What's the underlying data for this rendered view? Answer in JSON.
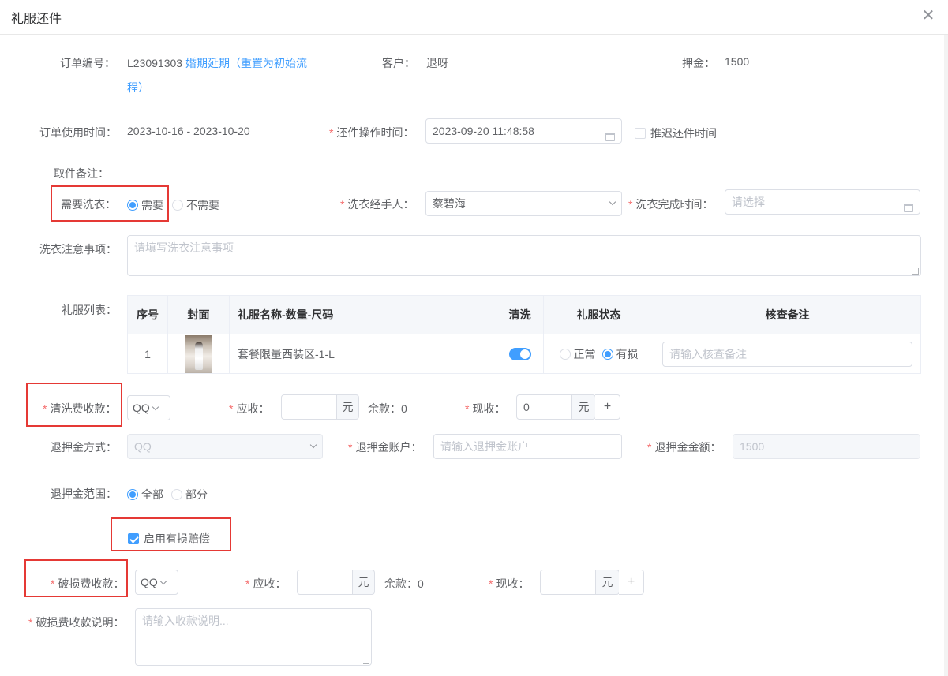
{
  "dialog": {
    "title": "礼服还件",
    "close_icon": "close-icon"
  },
  "order": {
    "no_label": "订单编号：",
    "no_value": "L23091303",
    "no_link_line1": "婚期延期（重置为初始流",
    "no_link_line2": "程）",
    "customer_label": "客户：",
    "customer_value": "退呀",
    "deposit_label": "押金：",
    "deposit_value": "1500",
    "use_time_label": "订单使用时间：",
    "use_time_value": "2023-10-16 - 2023-10-20",
    "return_time_label": "还件操作时间：",
    "return_time_value": "2023-09-20 11:48:58",
    "delay_label": "推迟还件时间",
    "pickup_note_label": "取件备注："
  },
  "wash": {
    "need_label": "需要洗衣：",
    "need_yes": "需要",
    "need_no": "不需要",
    "handler_label": "洗衣经手人：",
    "handler_value": "蔡碧海",
    "finish_label": "洗衣完成时间：",
    "finish_placeholder": "请选择",
    "notes_label": "洗衣注意事项：",
    "notes_placeholder": "请填写洗衣注意事项"
  },
  "dress_list": {
    "label": "礼服列表：",
    "headers": [
      "序号",
      "封面",
      "礼服名称-数量-尺码",
      "清洗",
      "礼服状态",
      "核查备注"
    ],
    "rows": [
      {
        "index": "1",
        "name": "套餐限量西装区-1-L",
        "status_normal": "正常",
        "status_damaged": "有损",
        "note_placeholder": "请输入核查备注"
      }
    ]
  },
  "cleaning_fee": {
    "label": "清洗费收款：",
    "method": "QQ",
    "receivable_label": "应收：",
    "unit": "元",
    "balance": "余款：0",
    "received_label": "现收：",
    "received_value": "0",
    "plus": "+"
  },
  "refund": {
    "method_label": "退押金方式：",
    "method_value": "QQ",
    "account_label": "退押金账户：",
    "account_placeholder": "请输入退押金账户",
    "amount_label": "退押金金额：",
    "amount_value": "1500",
    "scope_label": "退押金范围：",
    "scope_all": "全部",
    "scope_part": "部分"
  },
  "damage": {
    "enable_label": "启用有损赔偿",
    "fee_label": "破损费收款：",
    "method": "QQ",
    "receivable_label": "应收：",
    "unit": "元",
    "balance": "余款：0",
    "received_label": "现收：",
    "plus": "+",
    "desc_label": "破损费收款说明：",
    "desc_placeholder": "请输入收款说明..."
  },
  "colors": {
    "primary": "#409eff",
    "danger": "#f56c6c",
    "highlight": "#e53935"
  }
}
